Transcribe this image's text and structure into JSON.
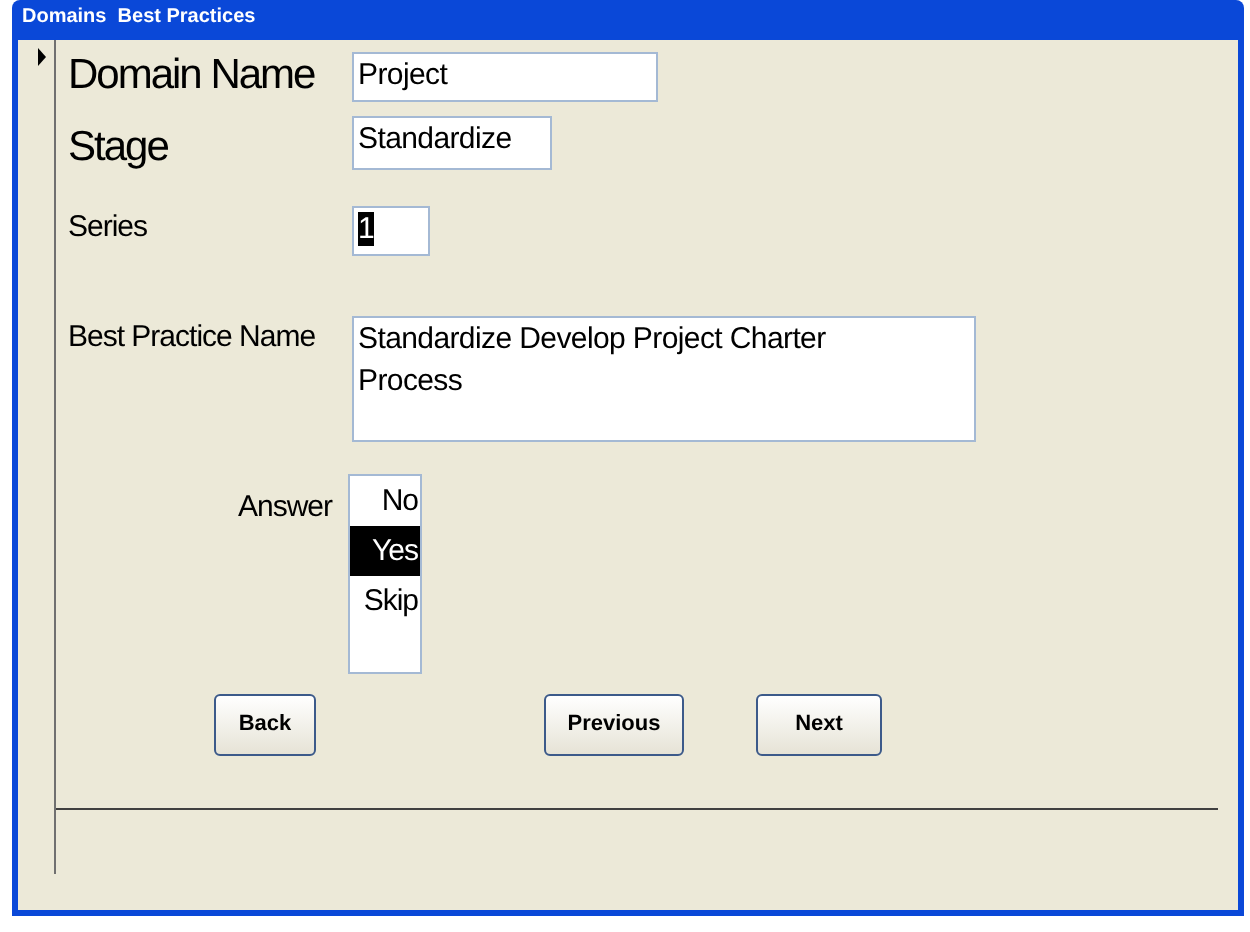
{
  "window": {
    "title": "Domains  Best Practices"
  },
  "record_selector": {
    "current": true
  },
  "fields": [
    {
      "label": "Domain Name",
      "value": "Project",
      "kind": "heading"
    },
    {
      "label": "Stage",
      "value": "Standardize",
      "kind": "heading"
    },
    {
      "label": "Series",
      "value": "1",
      "kind": "plain"
    },
    {
      "label": "Best Practice Name",
      "value": "Standardize Develop Project Charter Process",
      "kind": "plain"
    }
  ],
  "answer": {
    "label": "Answer",
    "options": [
      {
        "label": "No",
        "selected": false
      },
      {
        "label": "Yes",
        "selected": true
      },
      {
        "label": "Skip",
        "selected": false
      }
    ]
  },
  "buttons": [
    "Back",
    "Previous",
    "Next"
  ]
}
